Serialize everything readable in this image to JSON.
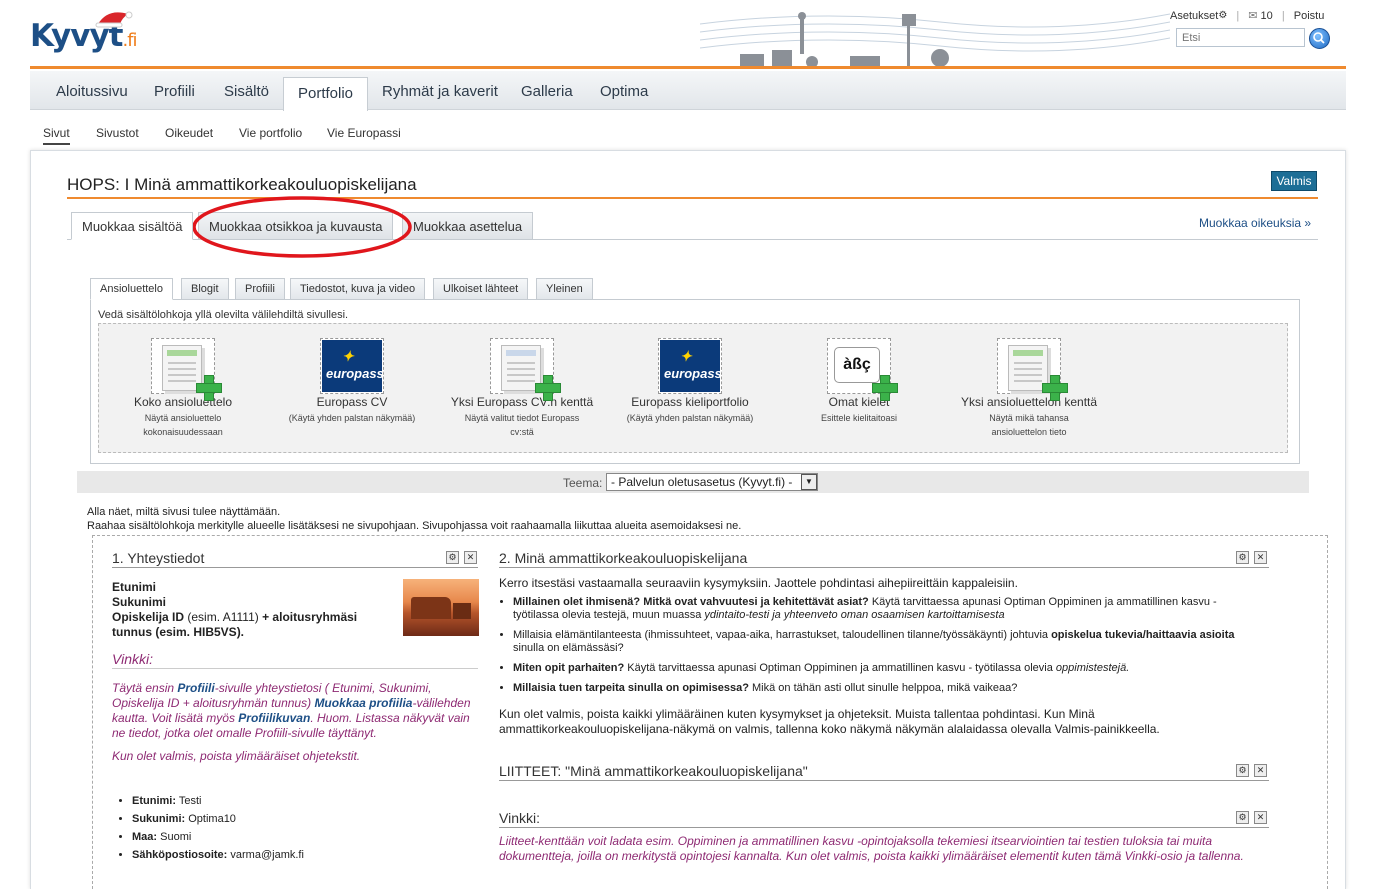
{
  "header": {
    "logo_main": "Kyvyt",
    "logo_suffix": ".fi",
    "settings_label": "Asetukset",
    "messages_count": "10",
    "logout_label": "Poistu",
    "search_placeholder": "Etsi"
  },
  "main_nav": [
    {
      "label": "Aloitussivu"
    },
    {
      "label": "Profiili"
    },
    {
      "label": "Sisältö"
    },
    {
      "label": "Portfolio"
    },
    {
      "label": "Ryhmät ja kaverit"
    },
    {
      "label": "Galleria"
    },
    {
      "label": "Optima"
    }
  ],
  "sub_nav": [
    {
      "label": "Sivut"
    },
    {
      "label": "Sivustot"
    },
    {
      "label": "Oikeudet"
    },
    {
      "label": "Vie portfolio"
    },
    {
      "label": "Vie Europassi"
    }
  ],
  "page": {
    "title": "HOPS: I Minä ammattikorkeakouluopiskelijana",
    "done_label": "Valmis",
    "edit_tabs": [
      {
        "label": "Muokkaa sisältöä"
      },
      {
        "label": "Muokkaa otsikkoa ja kuvausta"
      },
      {
        "label": "Muokkaa asettelua"
      }
    ],
    "edit_rights_link": "Muokkaa oikeuksia »"
  },
  "block_panel": {
    "tabs": [
      {
        "label": "Ansioluettelo"
      },
      {
        "label": "Blogit"
      },
      {
        "label": "Profiili"
      },
      {
        "label": "Tiedostot, kuva ja video"
      },
      {
        "label": "Ulkoiset lähteet"
      },
      {
        "label": "Yleinen"
      }
    ],
    "hint": "Vedä sisältölohkoja yllä olevilta välilehdiltä sivullesi.",
    "blocks": [
      {
        "name": "Koko ansioluettelo",
        "desc1": "Näytä ansioluettelo",
        "desc2": "kokonaisuudessaan",
        "icon": "resume-document-icon"
      },
      {
        "name": "Europass CV",
        "desc1": "(Käytä yhden palstan näkymää)",
        "desc2": "",
        "icon": "europass-icon",
        "icon_text": "europass"
      },
      {
        "name": "Yksi Europass CV:n kenttä",
        "desc1": "Näytä valitut tiedot Europass",
        "desc2": "cv:stä",
        "icon": "europass-document-icon"
      },
      {
        "name": "Europass kieliportfolio",
        "desc1": "(Käytä yhden palstan näkymää)",
        "desc2": "",
        "icon": "europass-icon",
        "icon_text": "europass"
      },
      {
        "name": "Omat kielet",
        "desc1": "Esittele kielitaitoasi",
        "desc2": "",
        "icon": "language-chars-icon",
        "icon_text": "àßç"
      },
      {
        "name": "Yksi ansioluettelon kenttä",
        "desc1": "Näytä mikä tahansa",
        "desc2": "ansioluettelon tieto",
        "icon": "resume-document-icon"
      }
    ]
  },
  "theme": {
    "label": "Teema:",
    "selected": "- Palvelun oletusasetus (Kyvyt.fi) -"
  },
  "preview": {
    "note1": "Alla näet, miltä sivusi tulee näyttämään.",
    "note2": "Raahaa sisältölohkoja merkitylle alueelle lisätäksesi ne sivupohjaan. Sivupohjassa voit raahaamalla liikuttaa alueita asemoidaksesi ne."
  },
  "left_column": {
    "title": "1. Yhteystiedot",
    "name1": "Etunimi",
    "name2": "Sukunimi",
    "student_id_label": "Opiskelija ID",
    "student_id_example": "(esim. A1111)",
    "plus_group": "+ aloitusryhmäsi",
    "group_label": "tunnus (esim. HIB5VS).",
    "tip_title": "Vinkki:",
    "tip_part1": "Täytä ensin ",
    "tip_link1": "Profiili",
    "tip_part2": "-sivulle yhteystietosi ( Etunimi, Sukunimi, Opiskelija ID + aloitusryhmän tunnus) ",
    "tip_link2": "Muokkaa profiilia",
    "tip_part3": "-välilehden kautta. Voit lisätä myös ",
    "tip_link3": "Profiilikuvan",
    "tip_part4": ". Huom. Listassa näkyvät vain ne tiedot, jotka olet omalle Profiili-sivulle täyttänyt.",
    "tip_done": "Kun olet valmis, poista ylimääräiset ohjetekstit.",
    "contacts": [
      {
        "label": "Etunimi:",
        "value": "Testi"
      },
      {
        "label": "Sukunimi:",
        "value": "Optima10"
      },
      {
        "label": "Maa:",
        "value": "Suomi"
      },
      {
        "label": "Sähköpostiosoite:",
        "value": "varma@jamk.fi"
      }
    ]
  },
  "right_column": {
    "title": "2. Minä ammattikorkeakouluopiskelijana",
    "intro": "Kerro itsestäsi vastaamalla seuraaviin kysymyksiin. Jaottele pohdintasi aihepiireittäin kappaleisiin.",
    "q1_bold": "Millainen olet ihmisenä? Mitkä ovat vahvuutesi ja kehitettävät asiat?",
    "q1_rest": " Käytä tarvittaessa apunasi Optiman Oppiminen ja ammatillinen kasvu -työtilassa olevia testejä, muun muassa ",
    "q1_italic": "ydintaito-testi ja yhteenveto oman osaamisen kartoittamisesta",
    "q2_start": "Millaisia elämäntilanteesta (ihmissuhteet, vapaa-aika, harrastukset, taloudellinen tilanne/työssäkäynti) johtuvia ",
    "q2_bold": "opiskelua tukevia/haittaavia asioita",
    "q2_end": " sinulla on elämässäsi?",
    "q3_bold": "Miten opit parhaiten?",
    "q3_rest": " Käytä tarvittaessa apunasi Optiman Oppiminen ja ammatillinen kasvu - työtilassa olevia ",
    "q3_italic": "oppimistestejä.",
    "q4_bold": "Millaisia tuen tarpeita sinulla on opimisessa?",
    "q4_rest": " Mikä on tähän asti ollut sinulle helppoa, mikä vaikeaa?",
    "outro": "Kun olet valmis, poista kaikki ylimääräinen kuten kysymykset ja ohjeteksit. Muista tallentaa pohdintasi. Kun Minä ammattikorkeakouluopiskelijana-näkymä on valmis, tallenna koko näkymä näkymän alalaidassa olevalla Valmis-painikkeella.",
    "attachments_title": "LIITTEET: \"Minä ammattikorkeakouluopiskelijana\"",
    "tip_title": "Vinkki:",
    "tip_text": "Liitteet-kenttään voit ladata esim. Oppiminen ja ammatillinen kasvu -opintojaksolla tekemiesi itsearviointien tai testien tuloksia tai muita dokumentteja, joilla on merkitystä opintojesi kannalta. Kun olet valmis, poista kaikki ylimääräiset elementit kuten tämä Vinkki-osio ja tallenna."
  },
  "colors": {
    "accent_orange": "#ef8a2f",
    "brand_blue": "#1d4f86",
    "tip_purple": "#8e2a73",
    "annotation_red": "#e0161c"
  }
}
